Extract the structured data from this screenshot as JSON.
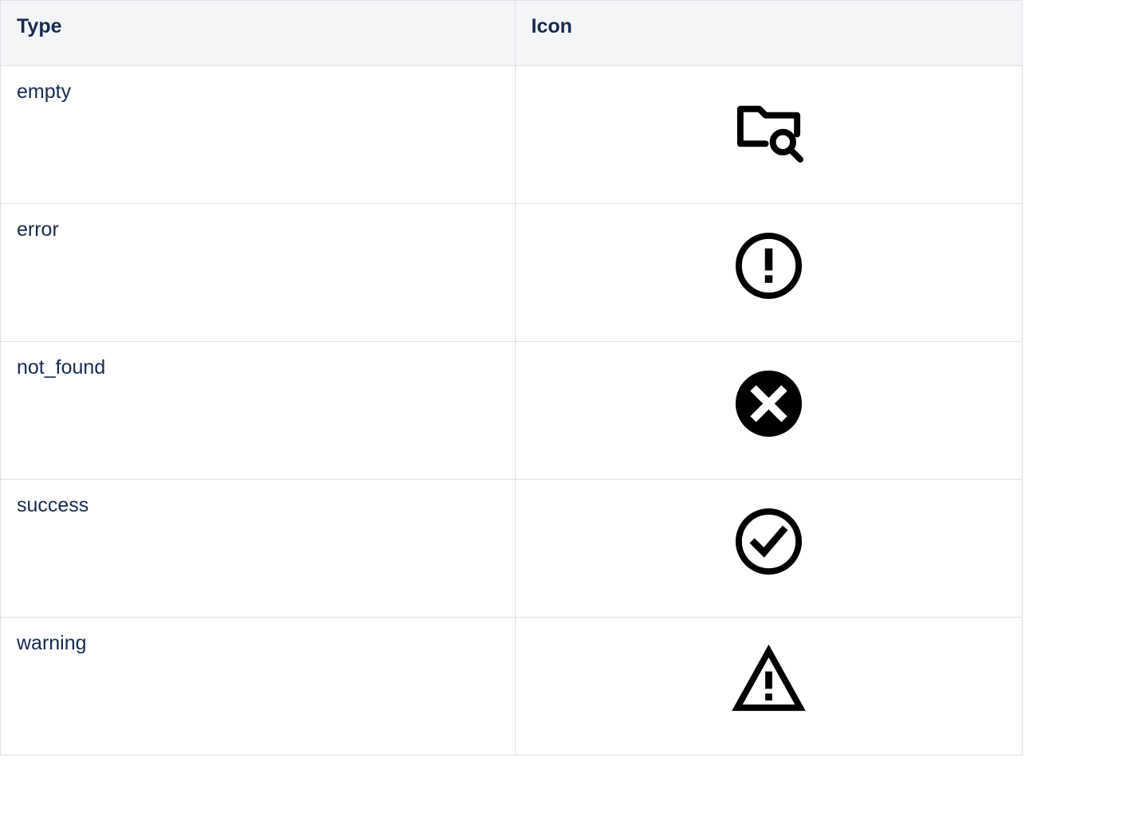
{
  "table": {
    "headers": {
      "type": "Type",
      "icon": "Icon"
    },
    "rows": [
      {
        "type": "empty",
        "icon_name": "folder-search-icon"
      },
      {
        "type": "error",
        "icon_name": "exclamation-circle-icon"
      },
      {
        "type": "not_found",
        "icon_name": "x-circle-filled-icon"
      },
      {
        "type": "success",
        "icon_name": "check-circle-icon"
      },
      {
        "type": "warning",
        "icon_name": "exclamation-triangle-icon"
      }
    ]
  }
}
